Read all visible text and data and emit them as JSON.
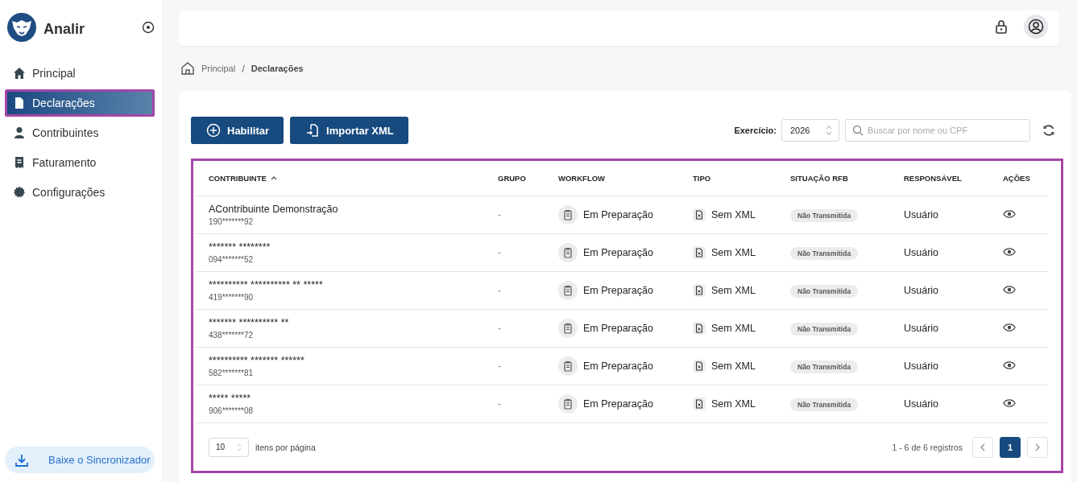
{
  "brand": {
    "name": "Analir"
  },
  "sidebar": {
    "items": [
      {
        "label": "Principal",
        "selected": false,
        "highlighted": false
      },
      {
        "label": "Declarações",
        "selected": true,
        "highlighted": true
      },
      {
        "label": "Contribuintes",
        "selected": false,
        "highlighted": false
      },
      {
        "label": "Faturamento",
        "selected": false,
        "highlighted": false
      },
      {
        "label": "Configurações",
        "selected": false,
        "highlighted": false
      }
    ],
    "download_button": "Baixe o Sincronizador"
  },
  "breadcrumb": [
    {
      "label": "Principal",
      "current": false
    },
    {
      "separator": "/",
      "label": "Declarações",
      "current": true
    }
  ],
  "toolbar": {
    "buttons": [
      {
        "label": "Habilitar"
      },
      {
        "label": "Importar XML"
      }
    ],
    "exercicio_label": "Exercício:",
    "exercicio_value": "2026",
    "search": {
      "placeholder": "Buscar por nome ou CPF"
    }
  },
  "table": {
    "highlighted": true,
    "columns": [
      {
        "label": "CONTRIBUINTE",
        "sorted": true
      },
      {
        "label": "GRUPO",
        "sorted": false
      },
      {
        "label": "WORKFLOW",
        "sorted": false
      },
      {
        "label": "TIPO",
        "sorted": false
      },
      {
        "label": "SITUAÇÃO RFB",
        "sorted": false
      },
      {
        "label": "RESPONSÁVEL",
        "sorted": false
      },
      {
        "label": "AÇÕES",
        "sorted": false
      }
    ],
    "rows": [
      {
        "name": "AContribuinte Demonstração",
        "cpf": "190*******92",
        "grupo": "-",
        "workflow": "Em Preparação",
        "tipo": "Sem XML",
        "situacao": "Não Transmitida",
        "responsavel": "Usuário"
      },
      {
        "name": "******* ********",
        "cpf": "094*******52",
        "grupo": "-",
        "workflow": "Em Preparação",
        "tipo": "Sem XML",
        "situacao": "Não Transmitida",
        "responsavel": "Usuário"
      },
      {
        "name": "********** ********** ** *****",
        "cpf": "419*******90",
        "grupo": "-",
        "workflow": "Em Preparação",
        "tipo": "Sem XML",
        "situacao": "Não Transmitida",
        "responsavel": "Usuário"
      },
      {
        "name": "******* ********** **",
        "cpf": "438*******72",
        "grupo": "-",
        "workflow": "Em Preparação",
        "tipo": "Sem XML",
        "situacao": "Não Transmitida",
        "responsavel": "Usuário"
      },
      {
        "name": "********** ******* ******",
        "cpf": "582*******81",
        "grupo": "-",
        "workflow": "Em Preparação",
        "tipo": "Sem XML",
        "situacao": "Não Transmitida",
        "responsavel": "Usuário"
      },
      {
        "name": "***** *****",
        "cpf": "906*******08",
        "grupo": "-",
        "workflow": "Em Preparação",
        "tipo": "Sem XML",
        "situacao": "Não Transmitida",
        "responsavel": "Usuário"
      }
    ]
  },
  "pagination": {
    "page_size": "10",
    "page_size_label": "itens por página",
    "summary": "1 - 6 de 6 registros",
    "pages": [
      {
        "label": "1",
        "selected": true
      }
    ]
  }
}
